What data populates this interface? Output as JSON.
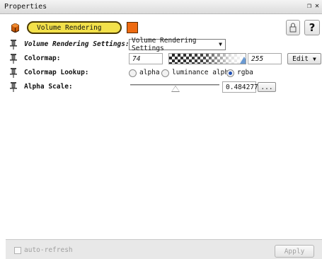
{
  "window": {
    "title": "Properties",
    "controls": [
      "restore-icon",
      "close-icon"
    ]
  },
  "module": {
    "name": "Volume Rendering",
    "pill_color": "#f3e14a",
    "swatch_color": "#ee6a10",
    "help_label": "?"
  },
  "fields": {
    "settings": {
      "label": "Volume Rendering Settings:",
      "value": "Volume Rendering Settings"
    },
    "colormap": {
      "label": "Colormap:",
      "min": "74",
      "max": "255",
      "edit_label": "Edit"
    },
    "lookup": {
      "label": "Colormap Lookup:",
      "options": [
        "alpha",
        "luminance alpha",
        "rgba"
      ],
      "selected": "rgba"
    },
    "alpha_scale": {
      "label": "Alpha Scale:",
      "value": "0.484277",
      "fraction": 0.48,
      "more_label": "..."
    }
  },
  "footer": {
    "auto_refresh_label": "auto-refresh",
    "auto_refresh_checked": false,
    "apply_label": "Apply"
  }
}
